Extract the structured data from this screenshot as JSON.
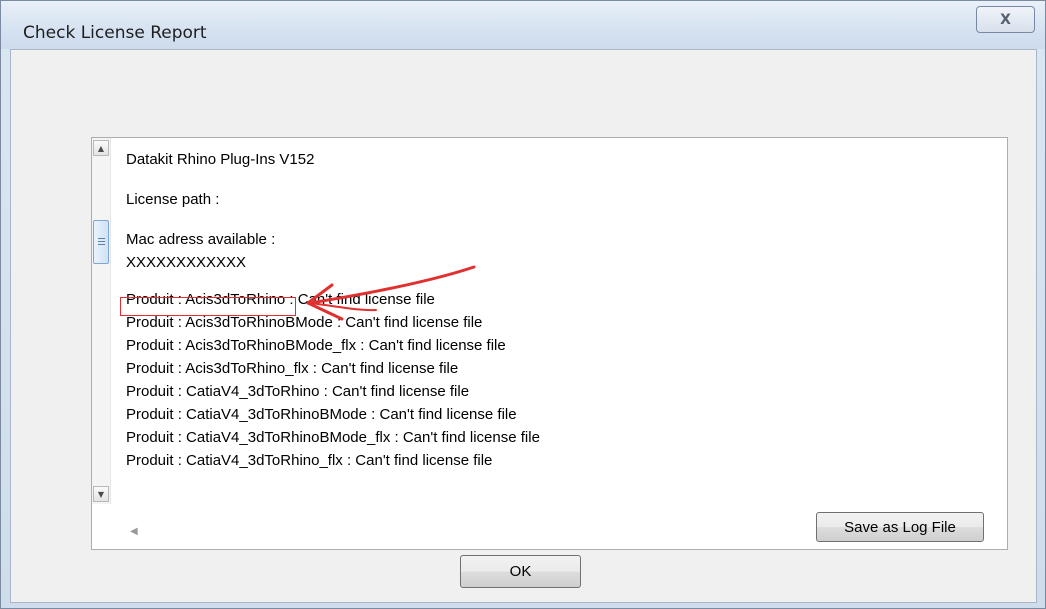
{
  "window": {
    "title": "Check License Report",
    "close_glyph": "X"
  },
  "report": {
    "header": "Datakit Rhino Plug-Ins V152",
    "license_path_label": "License path :",
    "mac_label": "Mac adress available :",
    "mac_value": "XXXXXXXXXXXX",
    "products": [
      "Produit : Acis3dToRhino : Can't find license file",
      "Produit : Acis3dToRhinoBMode : Can't find license file",
      "Produit : Acis3dToRhinoBMode_flx : Can't find license file",
      "Produit : Acis3dToRhino_flx : Can't find license file",
      "Produit : CatiaV4_3dToRhino : Can't find license file",
      "Produit : CatiaV4_3dToRhinoBMode : Can't find license file",
      "Produit : CatiaV4_3dToRhinoBMode_flx : Can't find license file",
      "Produit : CatiaV4_3dToRhino_flx : Can't find license file"
    ]
  },
  "buttons": {
    "save_log": "Save as Log File",
    "ok": "OK"
  },
  "icons": {
    "scroll_up": "up-arrow-icon",
    "scroll_down": "down-arrow-icon",
    "scroll_left": "left-arrow-icon",
    "scroll_right": "right-arrow-icon",
    "annotation": "red-arrow-annotation"
  },
  "colors": {
    "annotation_red": "#e03030",
    "title_bar": "#d6e2f1"
  }
}
